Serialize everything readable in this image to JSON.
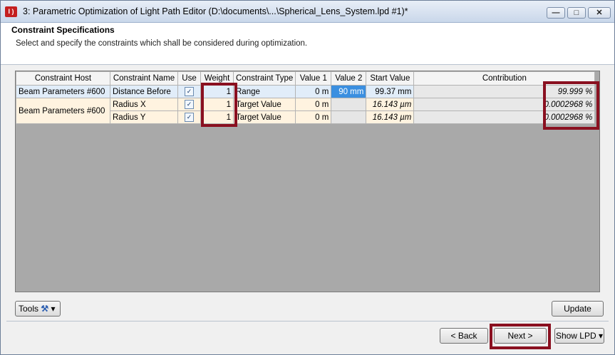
{
  "window": {
    "icon_text": "I )",
    "title": "3: Parametric Optimization of Light Path Editor (D:\\documents\\...\\Spherical_Lens_System.lpd #1)*",
    "min_glyph": "—",
    "max_glyph": "□",
    "close_glyph": "✕"
  },
  "header": {
    "title": "Constraint Specifications",
    "subtitle": "Select and specify the constraints which shall be considered during optimization."
  },
  "grid": {
    "columns": [
      "Constraint Host",
      "Constraint Name",
      "Use",
      "Weight",
      "Constraint Type",
      "Value 1",
      "Value 2",
      "Start Value",
      "Contribution"
    ],
    "rows": [
      {
        "host": "Beam Parameters #600",
        "name": "Distance Before",
        "use": "✓",
        "weight": "1",
        "type": "Range",
        "value1": "0 m",
        "value2": "90 mm",
        "start": "99.37 mm",
        "contribution": "99.999 %"
      },
      {
        "host": "Beam Parameters #600",
        "name": "Radius X",
        "use": "✓",
        "weight": "1",
        "type": "Target Value",
        "value1": "0 m",
        "value2": "",
        "start": "16.143 µm",
        "contribution": "0.0002968 %"
      },
      {
        "host": "",
        "name": "Radius Y",
        "use": "✓",
        "weight": "1",
        "type": "Target Value",
        "value1": "0 m",
        "value2": "",
        "start": "16.143 µm",
        "contribution": "0.0002968 %"
      }
    ]
  },
  "buttons": {
    "tools": "Tools",
    "tools_arrow": "▾",
    "update": "Update",
    "back": "< Back",
    "next": "Next >",
    "show_lpd": "Show LPD",
    "show_lpd_arrow": "▾"
  },
  "colors": {
    "highlight": "#8a1020",
    "selected_cell": "#3b8fe0",
    "row_blue": "#e1edf9",
    "row_cream": "#fff3e0"
  }
}
